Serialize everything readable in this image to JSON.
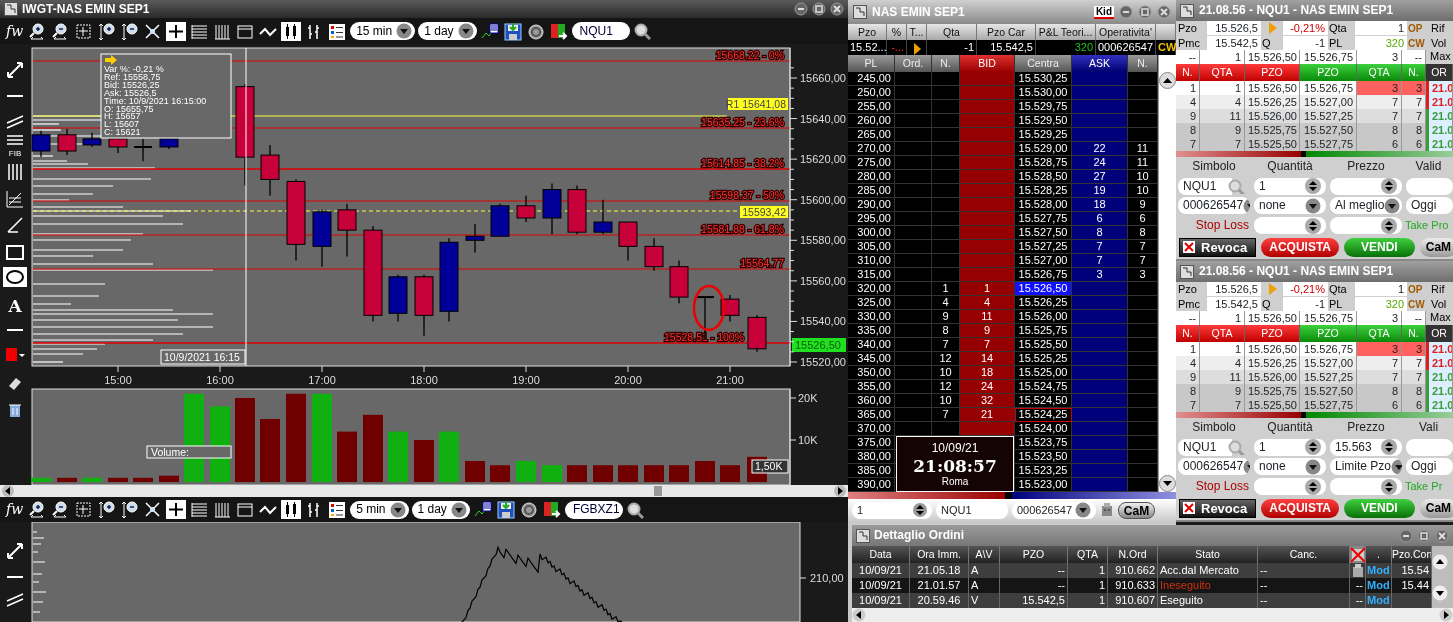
{
  "chart_window": {
    "title": "IWGT-NAS EMIN SEP1",
    "toolbar": {
      "logo": "fw",
      "timeframe": "15 min",
      "period": "1 day",
      "symbol": "NQU1"
    },
    "drawing_tools": {
      "fib_label": "FIB",
      "text_tool": "A"
    },
    "tooltip": [
      "Var %: -0,21 %",
      "Ref: 15558,75",
      "Bid: 15526,25",
      "Ask: 15526,5",
      "Time: 10/9/2021 16:15:00",
      "O: 15655,75",
      "H: 15657",
      "L: 15607",
      "C: 15621"
    ],
    "levels": [
      {
        "text": "15668.22 - 0%",
        "kind": "fib"
      },
      {
        "text": "R1 15641,08",
        "kind": "pivot"
      },
      {
        "text": "15635.25 - 23.6%",
        "kind": "fib"
      },
      {
        "text": "15614.85 - 38.2%",
        "kind": "fib"
      },
      {
        "text": "15598.37 - 50%",
        "kind": "fib"
      },
      {
        "text": "15593,42",
        "kind": "average"
      },
      {
        "text": "15581.88 - 61.8%",
        "kind": "fib"
      },
      {
        "text": "15564.77",
        "kind": "fib"
      },
      {
        "text": "15528.51 - 100%",
        "kind": "fib"
      },
      {
        "text": "15526,50",
        "kind": "last"
      }
    ],
    "y_ticks": [
      "15660,00",
      "15640,00",
      "15620,00",
      "15600,00",
      "15580,00",
      "15560,00",
      "15540,00",
      "15520,00"
    ],
    "x_ticks": [
      "15:00",
      "16:00",
      "17:00",
      "18:00",
      "19:00",
      "20:00",
      "21:00"
    ],
    "crosshair_label": "10/9/2021 16:15",
    "volume": {
      "label": "Volume:",
      "y_ticks": [
        "20K",
        "10K"
      ],
      "last": "1,50K"
    },
    "second_chart": {
      "toolbar": {
        "logo": "fw",
        "timeframe": "5 min",
        "period": "1 day",
        "symbol": "FGBXZ1"
      },
      "y_ticks": [
        "210,00"
      ]
    }
  },
  "dom": {
    "title": "NAS EMIN SEP1",
    "kid": "Kid",
    "summary": [
      {
        "header": "Pzo",
        "value": "15.52...",
        "kind": "text"
      },
      {
        "header": "%",
        "value": "-...",
        "kind": "change"
      },
      {
        "header": "T...",
        "kind": "arrow"
      },
      {
        "header": "Qta",
        "value": "-1",
        "kind": "text"
      },
      {
        "header": "Pzo Car",
        "value": "15.542,5",
        "kind": "text"
      },
      {
        "header": "P&L Teori...",
        "value": "320",
        "kind": "profit"
      },
      {
        "header": "Operativita'",
        "value": "000626547",
        "kind": "text"
      }
    ],
    "cw": "CW",
    "columns": [
      "PL",
      "Ord.",
      "N.",
      "BID",
      "Centra",
      "ASK",
      "N."
    ],
    "rows": [
      {
        "pl": "245,00",
        "centra": "15.530,25",
        "selected": false,
        "outlined": false
      },
      {
        "pl": "250,00",
        "centra": "15.530,00",
        "selected": false,
        "outlined": false
      },
      {
        "pl": "255,00",
        "centra": "15.529,75",
        "selected": false,
        "outlined": false
      },
      {
        "pl": "260,00",
        "centra": "15.529,50",
        "selected": false,
        "outlined": false
      },
      {
        "pl": "265,00",
        "centra": "15.529,25",
        "selected": false,
        "outlined": false
      },
      {
        "pl": "270,00",
        "centra": "15.529,00",
        "ask": "22",
        "n_ask": "11",
        "selected": false,
        "outlined": false
      },
      {
        "pl": "275,00",
        "centra": "15.528,75",
        "ask": "24",
        "n_ask": "11",
        "selected": false,
        "outlined": false
      },
      {
        "pl": "280,00",
        "centra": "15.528,50",
        "ask": "27",
        "n_ask": "10",
        "selected": false,
        "outlined": false
      },
      {
        "pl": "285,00",
        "centra": "15.528,25",
        "ask": "19",
        "n_ask": "10",
        "selected": false,
        "outlined": false
      },
      {
        "pl": "290,00",
        "centra": "15.528,00",
        "ask": "18",
        "n_ask": "9",
        "selected": false,
        "outlined": false
      },
      {
        "pl": "295,00",
        "centra": "15.527,75",
        "ask": "6",
        "n_ask": "6",
        "selected": false,
        "outlined": false
      },
      {
        "pl": "300,00",
        "centra": "15.527,50",
        "ask": "8",
        "n_ask": "8",
        "selected": false,
        "outlined": false
      },
      {
        "pl": "305,00",
        "centra": "15.527,25",
        "ask": "7",
        "n_ask": "7",
        "selected": false,
        "outlined": false
      },
      {
        "pl": "310,00",
        "centra": "15.527,00",
        "ask": "7",
        "n_ask": "7",
        "selected": false,
        "outlined": false
      },
      {
        "pl": "315,00",
        "centra": "15.526,75",
        "ask": "3",
        "n_ask": "3",
        "selected": false,
        "outlined": false
      },
      {
        "pl": "320,00",
        "n_bid": "1",
        "bid": "1",
        "centra": "15.526,50",
        "selected": true,
        "outlined": false
      },
      {
        "pl": "325,00",
        "n_bid": "4",
        "bid": "4",
        "centra": "15.526,25",
        "selected": false,
        "outlined": false
      },
      {
        "pl": "330,00",
        "n_bid": "9",
        "bid": "11",
        "centra": "15.526,00",
        "selected": false,
        "outlined": false
      },
      {
        "pl": "335,00",
        "n_bid": "8",
        "bid": "9",
        "centra": "15.525,75",
        "selected": false,
        "outlined": false
      },
      {
        "pl": "340,00",
        "n_bid": "7",
        "bid": "7",
        "centra": "15.525,50",
        "selected": false,
        "outlined": false
      },
      {
        "pl": "345,00",
        "n_bid": "12",
        "bid": "14",
        "centra": "15.525,25",
        "selected": false,
        "outlined": false
      },
      {
        "pl": "350,00",
        "n_bid": "10",
        "bid": "18",
        "centra": "15.525,00",
        "selected": false,
        "outlined": false
      },
      {
        "pl": "355,00",
        "n_bid": "12",
        "bid": "24",
        "centra": "15.524,75",
        "selected": false,
        "outlined": false
      },
      {
        "pl": "360,00",
        "n_bid": "10",
        "bid": "32",
        "centra": "15.524,50",
        "selected": false,
        "outlined": false
      },
      {
        "pl": "365,00",
        "n_bid": "7",
        "bid": "21",
        "centra": "15.524,25",
        "selected": false,
        "outlined": true
      },
      {
        "pl": "370,00",
        "centra": "15.524,00",
        "selected": false,
        "outlined": false
      },
      {
        "pl": "375,00",
        "centra": "15.523,75",
        "selected": false,
        "outlined": false
      },
      {
        "pl": "380,00",
        "centra": "15.523,50",
        "selected": false,
        "outlined": false
      },
      {
        "pl": "385,00",
        "centra": "15.523,25",
        "selected": false,
        "outlined": false
      },
      {
        "pl": "390,00",
        "centra": "15.523,00",
        "selected": false,
        "outlined": false
      }
    ],
    "clock": {
      "date": "10/09/21",
      "time": "21:08:57",
      "city": "Roma"
    },
    "footer": {
      "quantity": "1",
      "symbol": "NQU1",
      "account": "000626547",
      "button": "CaM"
    }
  },
  "order_panels": [
    {
      "title": "21.08.56 - NQU1 - NAS EMIN SEP1",
      "pzo_label": "Pzo",
      "pzo": "15.526,5",
      "change": "-0,21%",
      "qta_label": "Qta",
      "qta": "1",
      "op": "OP",
      "pmc_label": "Pmc",
      "pmc": "15.542,5",
      "q_label": "Q",
      "q": "-1",
      "pl_label": "PL",
      "pl": "320",
      "cw": "CW",
      "side_labels": [
        "Rif",
        "Vol",
        "Max"
      ],
      "best": [
        "--",
        "1",
        "15.526,50",
        "15.526,75",
        "3",
        "--"
      ],
      "book_columns": [
        "N.",
        "QTA",
        "PZO",
        "PZO",
        "QTA",
        "N.",
        "OR"
      ],
      "book": [
        {
          "n_bid": "1",
          "bid_qty": "1",
          "bid": "15.526,50",
          "ask": "15.526,75",
          "ask_qty": "3",
          "n_ask": "3",
          "highlighted": true,
          "side": "21.0",
          "color": "#e02020"
        },
        {
          "n_bid": "4",
          "bid_qty": "4",
          "bid": "15.526,25",
          "ask": "15.527,00",
          "ask_qty": "7",
          "n_ask": "7",
          "highlighted": false,
          "side": "21.0",
          "color": "#e02020"
        },
        {
          "n_bid": "9",
          "bid_qty": "11",
          "bid": "15.526,00",
          "ask": "15.527,25",
          "ask_qty": "7",
          "n_ask": "7",
          "highlighted": false,
          "side": "21.0",
          "color": "#3c9c3c"
        },
        {
          "n_bid": "8",
          "bid_qty": "9",
          "bid": "15.525,75",
          "ask": "15.527,50",
          "ask_qty": "8",
          "n_ask": "8",
          "highlighted": false,
          "side": "21.0",
          "color": "#3c9c3c"
        },
        {
          "n_bid": "7",
          "bid_qty": "7",
          "bid": "15.525,50",
          "ask": "15.527,75",
          "ask_qty": "6",
          "n_ask": "6",
          "highlighted": false,
          "side": "21.0",
          "color": "#3c9c3c"
        }
      ],
      "form_labels": [
        "Simbolo",
        "Quantità",
        "Prezzo",
        "Valid"
      ],
      "symbol": "NQU1",
      "quantity": "1",
      "account": "000626547",
      "param": "none",
      "order_type": "Al meglio",
      "validity": "Oggi",
      "stop_loss": "Stop Loss",
      "take_profit": "Take Pro",
      "buttons": {
        "cancel": "Revoca",
        "buy": "ACQUISTA",
        "sell": "VENDI",
        "cam": "CaM"
      }
    },
    {
      "title": "21.08.56 - NQU1 - NAS EMIN SEP1",
      "pzo_label": "Pzo",
      "pzo": "15.526,5",
      "change": "-0,21%",
      "qta_label": "Qta",
      "qta": "1",
      "op": "OP",
      "pmc_label": "Pmc",
      "pmc": "15.542,5",
      "q_label": "Q",
      "q": "-1",
      "pl_label": "PL",
      "pl": "320",
      "cw": "CW",
      "side_labels": [
        "Rif",
        "Vol",
        "Max"
      ],
      "best": [
        "--",
        "1",
        "15.526,50",
        "15.526,75",
        "3",
        "--"
      ],
      "book_columns": [
        "N.",
        "QTA",
        "PZO",
        "PZO",
        "QTA",
        "N.",
        "OR"
      ],
      "book": [
        {
          "n_bid": "1",
          "bid_qty": "1",
          "bid": "15.526,50",
          "ask": "15.526,75",
          "ask_qty": "3",
          "n_ask": "3",
          "highlighted": true,
          "side": "21.0",
          "color": "#e02020"
        },
        {
          "n_bid": "4",
          "bid_qty": "4",
          "bid": "15.526,25",
          "ask": "15.527,00",
          "ask_qty": "7",
          "n_ask": "7",
          "highlighted": false,
          "side": "21.0",
          "color": "#e02020"
        },
        {
          "n_bid": "9",
          "bid_qty": "11",
          "bid": "15.526,00",
          "ask": "15.527,25",
          "ask_qty": "7",
          "n_ask": "7",
          "highlighted": false,
          "side": "21.0",
          "color": "#3c9c3c"
        },
        {
          "n_bid": "8",
          "bid_qty": "9",
          "bid": "15.525,75",
          "ask": "15.527,50",
          "ask_qty": "8",
          "n_ask": "8",
          "highlighted": false,
          "side": "21.0",
          "color": "#3c9c3c"
        },
        {
          "n_bid": "7",
          "bid_qty": "7",
          "bid": "15.525,50",
          "ask": "15.527,75",
          "ask_qty": "6",
          "n_ask": "6",
          "highlighted": false,
          "side": "21.0",
          "color": "#3c9c3c"
        }
      ],
      "form_labels": [
        "Simbolo",
        "Quantità",
        "Prezzo",
        "Vali"
      ],
      "symbol": "NQU1",
      "quantity": "1",
      "price": "15.563",
      "account": "000626547",
      "param": "none",
      "order_type": "Limite Pzo",
      "validity": "Oggi",
      "stop_loss": "Stop Loss",
      "take_profit": "Take Pr",
      "buttons": {
        "cancel": "Revoca",
        "buy": "ACQUISTA",
        "sell": "VENDI",
        "cam": "CaM"
      }
    }
  ],
  "orders": {
    "title": "Dettaglio Ordini",
    "columns": [
      {
        "label": "Data"
      },
      {
        "label": "Ora Imm."
      },
      {
        "label": "A\\V"
      },
      {
        "label": "PZO"
      },
      {
        "label": "QTA"
      },
      {
        "label": "N.Ord"
      },
      {
        "label": "Stato"
      },
      {
        "label": "Canc."
      },
      {
        "kind": "icon"
      },
      {
        "label": "."
      },
      {
        "label": "Pzo.Con"
      }
    ],
    "rows": [
      {
        "date": "10/09/21",
        "time": "21.05.18",
        "side": "A",
        "price": "--",
        "qty": "1",
        "order_no": "910.662",
        "status": "Acc.dal Mercato",
        "rejected": false,
        "cancel": "--",
        "cancel_icon": true,
        "action": "Mod",
        "fill": "15.54",
        "selected": false
      },
      {
        "date": "10/09/21",
        "time": "21.01.57",
        "side": "A",
        "price": "--",
        "qty": "1",
        "order_no": "910.633",
        "status": "Ineseguito",
        "rejected": true,
        "cancel": "--",
        "cancel_icon": false,
        "cancel_text": "--",
        "action": "Mod",
        "fill": "15.44",
        "selected": true
      },
      {
        "date": "10/09/21",
        "time": "20.59.46",
        "side": "V",
        "price": "15.542,5",
        "qty": "1",
        "order_no": "910.607",
        "status": "Eseguito",
        "rejected": false,
        "cancel": "--",
        "cancel_icon": false,
        "cancel_text": "--",
        "action": "Mod",
        "selected": false
      }
    ]
  }
}
